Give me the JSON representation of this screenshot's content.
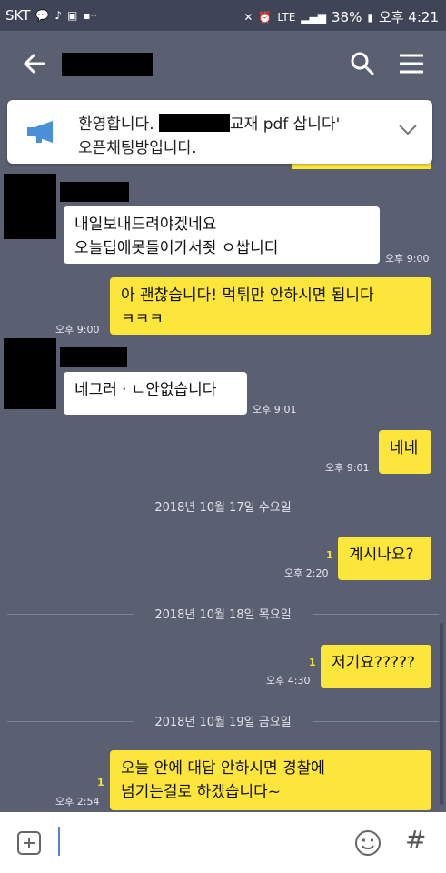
{
  "status_bar": {
    "carrier": "SKT",
    "battery": "38%",
    "time": "오후 4:21",
    "network": "LTE"
  },
  "notice": {
    "line1_prefix": "환영합니다.",
    "line1_suffix": "교재 pdf 삽니다'",
    "line2": "오픈채팅방입니다."
  },
  "messages": [
    {
      "lines": [
        "내일보내드려야겠네요",
        "오늘딥에못들어가서죗 ㅇ쌉니디"
      ],
      "time": "오후 9:00"
    },
    {
      "lines": [
        "아 괜찮습니다! 먹튀만 안하시면 됩니다",
        "ㅋㅋㅋ"
      ],
      "time": "오후 9:00"
    },
    {
      "lines": [
        "네그러ㆍㄴ안없습니다"
      ],
      "time": "오후 9:01"
    },
    {
      "lines": [
        "네네"
      ],
      "time": "오후 9:01"
    },
    {
      "lines": [
        "계시나요?"
      ],
      "time": "오후 2:20",
      "unread": "1"
    },
    {
      "lines": [
        "저기요?????"
      ],
      "time": "오후 4:30",
      "unread": "1"
    },
    {
      "lines": [
        "오늘 안에 대답 안하시면 경찰에",
        "넘기는걸로 하겠습니다~"
      ],
      "time": "오후 2:54",
      "unread": "1"
    }
  ],
  "date_separators": [
    "2018년 10월 17일 수요일",
    "2018년 10월 18일 목요일",
    "2018년 10월 19일 금요일"
  ],
  "input": {
    "icons": [
      "plus-icon",
      "emoji-icon",
      "hash-icon"
    ],
    "hash_glyph": "#"
  },
  "colors": {
    "background": "#5a6072",
    "outgoing": "#fce63c",
    "incoming": "#ffffff"
  }
}
